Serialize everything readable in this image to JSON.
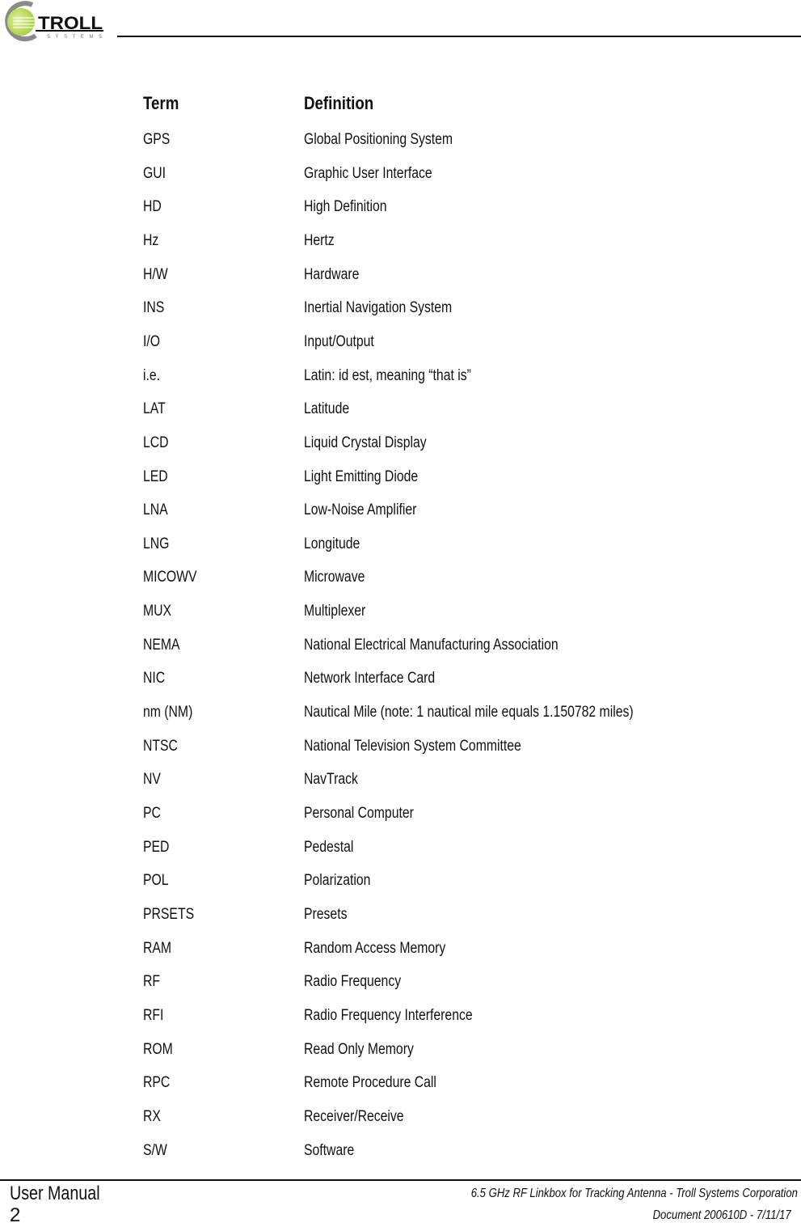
{
  "header": {
    "logo": {
      "name": "TROLL",
      "subname": "SYSTEMS",
      "brand_green": "#a6cf3a",
      "ring_gray": "#8a8a8a"
    }
  },
  "glossary": {
    "headers": {
      "term": "Term",
      "definition": "Definition"
    },
    "rows": [
      {
        "term": "GPS",
        "definition": "Global Positioning System"
      },
      {
        "term": "GUI",
        "definition": "Graphic User Interface"
      },
      {
        "term": "HD",
        "definition": "High Definition"
      },
      {
        "term": "Hz",
        "definition": "Hertz"
      },
      {
        "term": "H/W",
        "definition": "Hardware"
      },
      {
        "term": "INS",
        "definition": "Inertial Navigation System"
      },
      {
        "term": "I/O",
        "definition": "Input/Output"
      },
      {
        "term": "i.e.",
        "definition": "Latin: id est, meaning “that is”"
      },
      {
        "term": "LAT",
        "definition": "Latitude"
      },
      {
        "term": "LCD",
        "definition": "Liquid Crystal Display"
      },
      {
        "term": "LED",
        "definition": "Light Emitting Diode"
      },
      {
        "term": "LNA",
        "definition": "Low-Noise Amplifier"
      },
      {
        "term": "LNG",
        "definition": "Longitude"
      },
      {
        "term": "MICOWV",
        "definition": "Microwave"
      },
      {
        "term": "MUX",
        "definition": "Multiplexer"
      },
      {
        "term": "NEMA",
        "definition": "National Electrical Manufacturing Association"
      },
      {
        "term": "NIC",
        "definition": "Network Interface Card"
      },
      {
        "term": "nm (NM)",
        "definition": "Nautical Mile (note: 1 nautical mile equals 1.150782 miles)"
      },
      {
        "term": "NTSC",
        "definition": "National Television System Committee"
      },
      {
        "term": "NV",
        "definition": "NavTrack"
      },
      {
        "term": "PC",
        "definition": "Personal Computer"
      },
      {
        "term": "PED",
        "definition": "Pedestal"
      },
      {
        "term": "POL",
        "definition": "Polarization"
      },
      {
        "term": "PRSETS",
        "definition": "Presets"
      },
      {
        "term": "RAM",
        "definition": "Random Access Memory"
      },
      {
        "term": "RF",
        "definition": "Radio Frequency"
      },
      {
        "term": "RFI",
        "definition": "Radio Frequency Interference"
      },
      {
        "term": "ROM",
        "definition": "Read Only Memory"
      },
      {
        "term": "RPC",
        "definition": "Remote Procedure Call"
      },
      {
        "term": "RX",
        "definition": "Receiver/Receive"
      },
      {
        "term": "S/W",
        "definition": "Software"
      }
    ]
  },
  "footer": {
    "title": "User Manual",
    "page_number": "2",
    "product": "6.5 GHz RF Linkbox for Tracking Antenna - Troll Systems Corporation",
    "document": "Document 200610D - 7/11/17"
  }
}
